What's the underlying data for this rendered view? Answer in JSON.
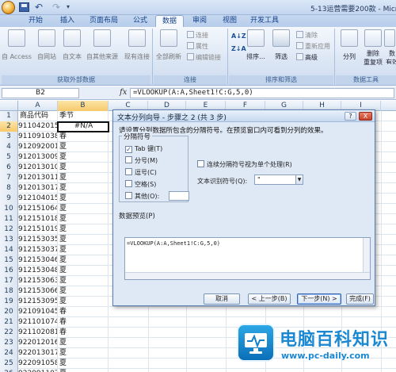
{
  "window": {
    "title": "5-13运营需要200款 - Micro"
  },
  "tabs": [
    "开始",
    "插入",
    "页面布局",
    "公式",
    "数据",
    "审阅",
    "视图",
    "开发工具"
  ],
  "active_tab": "数据",
  "ribbon": {
    "groups": {
      "external": "获取外部数据",
      "connections": "连接",
      "sort_filter": "排序和筛选",
      "data_tools": "数据工具"
    },
    "buttons": {
      "from_access": "自 Access",
      "from_web": "自网站",
      "from_text": "自文本",
      "from_other": "自其他来源",
      "existing_conn": "现有连接",
      "refresh_all": "全部刷新",
      "connections": "连接",
      "properties": "属性",
      "edit_links": "编辑链接",
      "sort": "排序...",
      "filter": "筛选",
      "clear": "清除",
      "reapply": "重新应用",
      "advanced": "高级",
      "text_to_columns": "分列",
      "remove_dup_1": "删除",
      "remove_dup_2": "重复项",
      "valid_1": "数",
      "valid_2": "有效"
    }
  },
  "formula_bar": {
    "name_box": "B2",
    "fx": "fx",
    "formula": "=VLOOKUP(A:A,Sheet1!C:G,5,0)"
  },
  "grid": {
    "columns": [
      "A",
      "B",
      "C",
      "D",
      "E",
      "F",
      "G",
      "H",
      "I"
    ],
    "active_column": "B",
    "active_row": "2",
    "rows": [
      {
        "n": "1",
        "a": "商品代码",
        "b": "季节"
      },
      {
        "n": "2",
        "a": "911042015",
        "b": "#N/A"
      },
      {
        "n": "3",
        "a": "911091038",
        "b": "春"
      },
      {
        "n": "4",
        "a": "912092001",
        "b": "夏"
      },
      {
        "n": "5",
        "a": "912013009",
        "b": "夏"
      },
      {
        "n": "6",
        "a": "912013010",
        "b": "夏"
      },
      {
        "n": "7",
        "a": "912013011",
        "b": "夏"
      },
      {
        "n": "8",
        "a": "912013017",
        "b": "夏"
      },
      {
        "n": "9",
        "a": "912104015",
        "b": "夏"
      },
      {
        "n": "10",
        "a": "912151064",
        "b": "夏"
      },
      {
        "n": "11",
        "a": "912151018",
        "b": "夏"
      },
      {
        "n": "12",
        "a": "912151019",
        "b": "夏"
      },
      {
        "n": "13",
        "a": "912153035",
        "b": "夏"
      },
      {
        "n": "14",
        "a": "912153037",
        "b": "夏"
      },
      {
        "n": "15",
        "a": "912153046",
        "b": "夏"
      },
      {
        "n": "16",
        "a": "912153048",
        "b": "夏"
      },
      {
        "n": "17",
        "a": "912153063",
        "b": "夏"
      },
      {
        "n": "18",
        "a": "912153066",
        "b": "夏"
      },
      {
        "n": "19",
        "a": "912153095",
        "b": "夏"
      },
      {
        "n": "20",
        "a": "921091045",
        "b": "春"
      },
      {
        "n": "21",
        "a": "921101074",
        "b": "春"
      },
      {
        "n": "22",
        "a": "921102081",
        "b": "春"
      },
      {
        "n": "23",
        "a": "922012016",
        "b": "夏"
      },
      {
        "n": "24",
        "a": "922013017",
        "b": "夏"
      },
      {
        "n": "25",
        "a": "922091058",
        "b": "夏"
      },
      {
        "n": "26",
        "a": "922091107",
        "b": "夏"
      },
      {
        "n": "27",
        "a": "922092051",
        "b": "夏"
      }
    ]
  },
  "dialog": {
    "title": "文本分列向导 - 步骤之 2 (共 3 步)",
    "help": "?",
    "close": "X",
    "description": "请设置分列数据所包含的分隔符号。在预览窗口内可看到分列的效果。",
    "delimiters_legend": "分隔符号",
    "options": [
      {
        "label": "Tab 键(T)",
        "checked": true
      },
      {
        "label": "分号(M)",
        "checked": false
      },
      {
        "label": "逗号(C)",
        "checked": false
      },
      {
        "label": "空格(S)",
        "checked": false
      },
      {
        "label": "其他(O):",
        "checked": false
      }
    ],
    "consecutive": "连续分隔符号视为单个处理(R)",
    "qualifier_label": "文本识别符号(Q):",
    "qualifier_value": "\"",
    "preview_label": "数据预览(P)",
    "preview_text": "=VLOOKUP(A:A,Sheet1!C:G,5,0)",
    "buttons": {
      "cancel": "取消",
      "back": "< 上一步(B)",
      "next": "下一步(N) >",
      "finish": "完成(F)"
    }
  },
  "watermark": {
    "title": "电脑百科知识",
    "url": "www.pc-daily.com"
  }
}
